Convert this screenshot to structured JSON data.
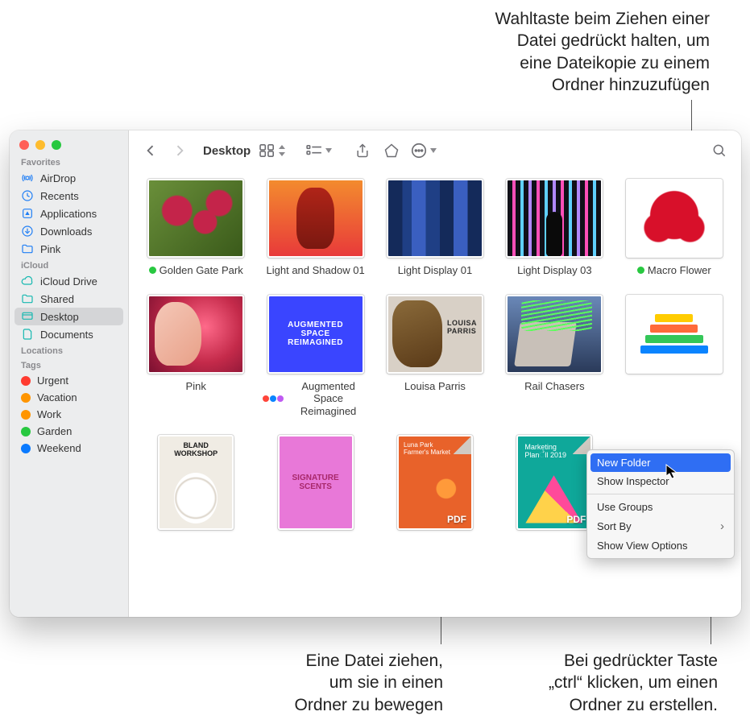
{
  "callouts": {
    "top": "Wahltaste beim Ziehen einer\nDatei gedrückt halten, um\neine Dateikopie zu einem\nOrdner hinzuzufügen",
    "bottom_left": "Eine Datei ziehen,\num sie in einen\nOrdner zu bewegen",
    "bottom_right": "Bei gedrückter Taste\n„ctrl“ klicken, um einen\nOrdner zu erstellen."
  },
  "window": {
    "title": "Desktop"
  },
  "sidebar": {
    "sections": [
      {
        "header": "Favorites",
        "items": [
          {
            "icon": "airdrop",
            "label": "AirDrop"
          },
          {
            "icon": "clock",
            "label": "Recents"
          },
          {
            "icon": "apps",
            "label": "Applications"
          },
          {
            "icon": "download",
            "label": "Downloads"
          },
          {
            "icon": "folder",
            "label": "Pink"
          }
        ]
      },
      {
        "header": "iCloud",
        "items": [
          {
            "icon": "cloud",
            "label": "iCloud Drive"
          },
          {
            "icon": "shared",
            "label": "Shared"
          },
          {
            "icon": "desktop",
            "label": "Desktop",
            "selected": true
          },
          {
            "icon": "doc",
            "label": "Documents"
          }
        ]
      },
      {
        "header": "Locations",
        "items": []
      },
      {
        "header": "Tags",
        "items": [
          {
            "tagColor": "#ff3b30",
            "label": "Urgent"
          },
          {
            "tagColor": "#ff9500",
            "label": "Vacation"
          },
          {
            "tagColor": "#ff9500",
            "label": "Work"
          },
          {
            "tagColor": "#28c840",
            "label": "Garden"
          },
          {
            "tagColor": "#0a7aff",
            "label": "Weekend"
          }
        ]
      }
    ]
  },
  "files": [
    {
      "label": "Golden Gate Park",
      "green": true,
      "art": "bg1"
    },
    {
      "label": "Light and Shadow 01",
      "green": false,
      "art": "bg2"
    },
    {
      "label": "Light Display 01",
      "green": false,
      "art": "bg3"
    },
    {
      "label": "Light Display 03",
      "green": false,
      "art": "bg4"
    },
    {
      "label": "Macro Flower",
      "green": true,
      "art": "bg5"
    },
    {
      "label": "Pink",
      "green": false,
      "art": "bg6"
    },
    {
      "label": "Augmented Space Reimagined",
      "green": false,
      "art": "bg7",
      "multi": true,
      "thumbText": "AUGMENTED\nSPACE\nREIMAGINED"
    },
    {
      "label": "Louisa Parris",
      "green": false,
      "art": "bg8"
    },
    {
      "label": "Rail Chasers",
      "green": false,
      "art": "bg9"
    },
    {
      "label": "",
      "green": false,
      "art": "bg10",
      "chart": true
    },
    {
      "label": "",
      "green": false,
      "art": "bg11",
      "square": true
    },
    {
      "label": "",
      "green": false,
      "art": "bg12",
      "square": true,
      "thumbText": "SIGNATURE\nSCENTS"
    },
    {
      "label": "",
      "green": false,
      "art": "bg13",
      "square": true,
      "pdf": true,
      "topText": "Luna Park\nFarmer's Market"
    },
    {
      "label": "",
      "green": false,
      "art": "bg14",
      "square": true,
      "pdf": true
    }
  ],
  "contextMenu": {
    "items": [
      {
        "label": "New Folder",
        "selected": true
      },
      {
        "label": "Show Inspector"
      },
      {
        "sep": true
      },
      {
        "label": "Use Groups"
      },
      {
        "label": "Sort By",
        "submenu": true
      },
      {
        "label": "Show View Options"
      }
    ]
  }
}
